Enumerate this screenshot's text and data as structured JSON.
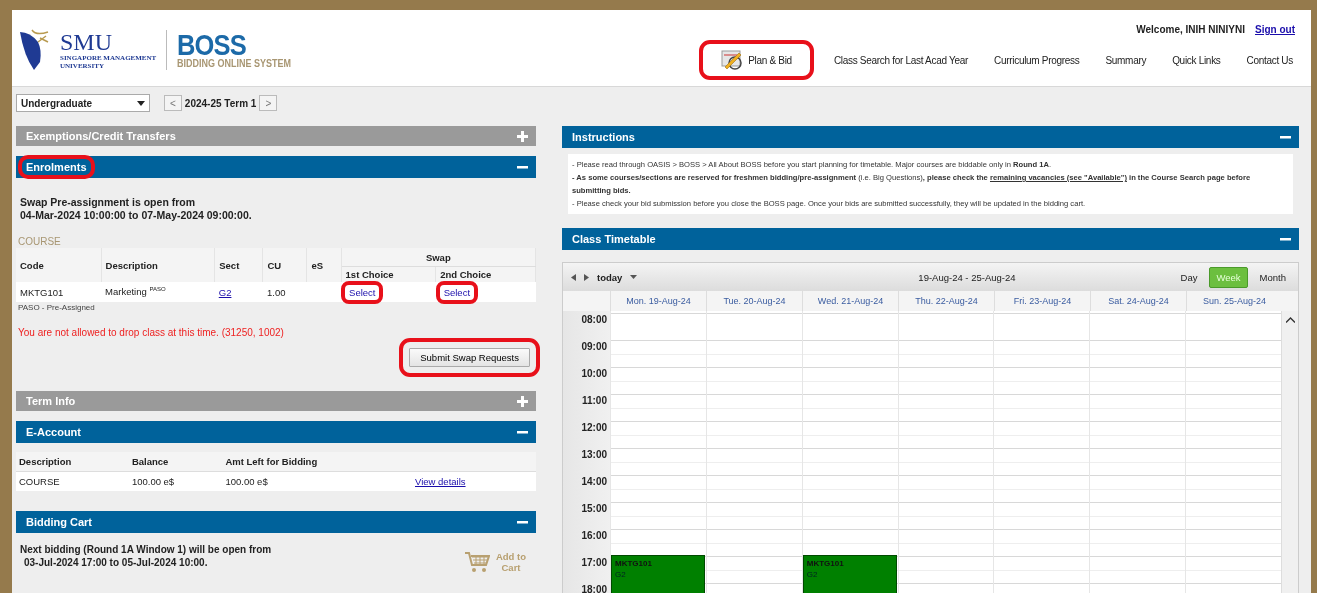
{
  "header": {
    "logo_name": "SMU",
    "logo_subtitle": [
      "SINGAPORE MANAGEMENT",
      "UNIVERSITY"
    ],
    "app_name": "BOSS",
    "app_subtitle": "BIDDING ONLINE SYSTEM",
    "welcome": "Welcome, INIH NINIYNI",
    "sign_out": "Sign out"
  },
  "nav": [
    {
      "label": "Plan & Bid",
      "kind": "icon",
      "highlighted": true
    },
    {
      "label": "Class Search for Last Acad Year",
      "kind": "text",
      "highlighted": false
    },
    {
      "label": "Curriculum Progress",
      "kind": "text",
      "highlighted": false
    },
    {
      "label": "Summary",
      "kind": "text",
      "highlighted": false
    },
    {
      "label": "Quick Links",
      "kind": "text",
      "highlighted": false
    },
    {
      "label": "Contact Us",
      "kind": "text",
      "highlighted": false
    }
  ],
  "term_bar": {
    "career": "Undergraduate",
    "term": "2024-25 Term 1",
    "prev": "<",
    "next": ">"
  },
  "exemptions": {
    "title": "Exemptions/Credit Transfers",
    "expanded": false
  },
  "enrolments": {
    "title": "Enrolments",
    "expanded": true,
    "highlighted": true,
    "notice_lines": [
      "Swap Pre-assignment is open from",
      "04-Mar-2024 10:00:00 to 07-May-2024 09:00:00."
    ],
    "course_label": "COURSE",
    "columns": [
      "Code",
      "Description",
      "Sect",
      "CU",
      "eS"
    ],
    "swap_header": "Swap",
    "swap_columns": [
      "1st Choice",
      "2nd Choice"
    ],
    "rows": [
      {
        "code": "MKTG101",
        "description": "Marketing $^{PASO}$",
        "section": "G2",
        "cu": "1.00",
        "choices": [
          {
            "label": "Select",
            "highlighted": true
          },
          {
            "label": "Select",
            "highlighted": true
          }
        ]
      }
    ],
    "legend": "PASO - Pre-Assigned",
    "error": "You are not allowed to drop class at this time. (31250, 1002)",
    "submit": {
      "label": "Submit Swap Requests",
      "highlighted": true
    }
  },
  "term_info": {
    "title": "Term Info",
    "expanded": false
  },
  "e_account": {
    "title": "E-Account",
    "expanded": true,
    "columns": [
      "Description",
      "Balance",
      "Amt Left for Bidding"
    ],
    "rows": [
      {
        "description": "COURSE",
        "balance": "100.00 e$",
        "amt_left": "100.00 e$",
        "link": "View details"
      }
    ]
  },
  "bidding_cart": {
    "title": "Bidding Cart",
    "expanded": true,
    "notice_lines": [
      "Next bidding (Round 1A Window 1) will be open from",
      "03-Jul-2024 17:00 to 05-Jul-2024 10:00."
    ],
    "add_to_cart": "Add to Cart"
  },
  "instructions": {
    "title": "Instructions",
    "expanded": true,
    "items": [
      {
        "text": "- Please read through OASIS > BOSS > All About BOSS before you start planning for timetable. Major courses are biddable only in **Round 1A**."
      },
      {
        "text": "**- As some courses/sections are reserved for freshmen bidding/pre-assignment** (i.e. Big Questions)**, please check the**",
        "link": "remaining vacancies (see \"Available\")",
        "after": " in the Course Search page before submitting bids."
      },
      {
        "text": "- Please check your bid submission before you close the BOSS page. Once your bids are submitted successfully, they will be updated in the bidding cart."
      }
    ]
  },
  "timetable": {
    "title": "Class Timetable",
    "expanded": true,
    "today": "today",
    "range": "19-Aug-24 - 25-Aug-24",
    "views": [
      {
        "label": "Day",
        "selected": false
      },
      {
        "label": "Week",
        "selected": true
      },
      {
        "label": "Month",
        "selected": false
      }
    ],
    "hours": [
      "08:00",
      "09:00",
      "10:00",
      "11:00",
      "12:00",
      "13:00",
      "14:00",
      "15:00",
      "16:00",
      "17:00",
      "18:00"
    ],
    "days": [
      {
        "label": "Mon. 19-Aug-24",
        "events": [
          {
            "code": "MKTG101",
            "section": "G2"
          }
        ]
      },
      {
        "label": "Tue. 20-Aug-24"
      },
      {
        "label": "Wed. 21-Aug-24",
        "events": [
          {
            "code": "MKTG101",
            "section": "G2"
          }
        ]
      },
      {
        "label": "Thu. 22-Aug-24"
      },
      {
        "label": "Fri. 23-Aug-24"
      },
      {
        "label": "Sat. 24-Aug-24"
      },
      {
        "label": "Sun. 25-Aug-24"
      }
    ]
  }
}
